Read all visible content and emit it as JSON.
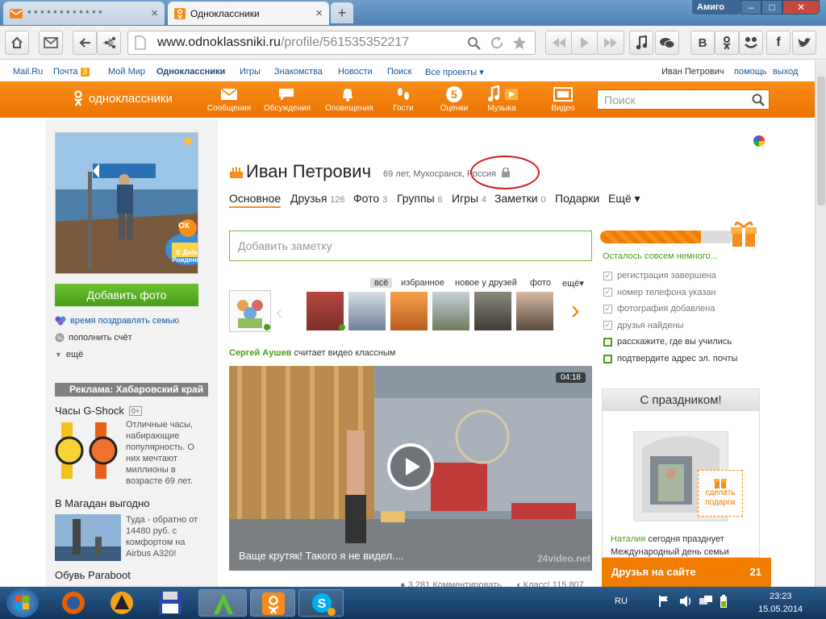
{
  "window": {
    "tabs": [
      {
        "title": "* * * * * * * * * * * *",
        "icon": "mail-icon"
      },
      {
        "title": "Одноклассники",
        "icon": "ok-icon"
      }
    ],
    "profile_label": "Амиго",
    "new_tab": "+"
  },
  "toolbar": {
    "url_main": "www.odnoklassniki.ru",
    "url_path": "/profile/561535352217"
  },
  "util_links": {
    "mailru": "Mail.Ru",
    "pochta": "Почта",
    "pochta_count": "3",
    "moymir": "Мой Мир",
    "ok": "Одноклассники",
    "igry": "Игры",
    "znakomstva": "Знакомства",
    "novosti": "Новости",
    "poisk": "Поиск",
    "all_projects": "Все проекты",
    "user": "Иван Петрович",
    "help": "помощь",
    "exit": "выход"
  },
  "okbar": {
    "logo": "одноклассники",
    "nav": [
      "Сообщения",
      "Обсуждения",
      "Оповещения",
      "Гости",
      "Оценки",
      "Музыка",
      "Видео"
    ],
    "search_placeholder": "Поиск"
  },
  "left": {
    "add_photo": "Добавить фото",
    "congrats_link": "время поздравлять семью",
    "topup": "пополнить счёт",
    "more": "ещё",
    "ad_header": "Реклама: Хабаровский край",
    "ads": [
      {
        "title": "Часы G-Shock",
        "badge": "0+",
        "text": "Отличные часы, набирающие популярность. О них мечтают миллионы в возрасте 69 лет."
      },
      {
        "title": "В Магадан выгодно",
        "text": "Туда - обратно от 14480 руб. с комфортом на Airbus A320!"
      },
      {
        "title": "Обувь Paraboot"
      }
    ],
    "avatar_badge_top": "ОК",
    "avatar_badge_text": "С Днём Рождения"
  },
  "profile": {
    "name": "Иван Петрович",
    "info": "69 лет, Мухосранск, Россия",
    "tabs": [
      {
        "label": "Основное",
        "count": ""
      },
      {
        "label": "Друзья",
        "count": "126"
      },
      {
        "label": "Фото",
        "count": "3"
      },
      {
        "label": "Группы",
        "count": "6"
      },
      {
        "label": "Игры",
        "count": "4"
      },
      {
        "label": "Заметки",
        "count": "0"
      },
      {
        "label": "Подарки",
        "count": ""
      },
      {
        "label": "Ещё ▾",
        "count": ""
      }
    ],
    "note_placeholder": "Добавить заметку"
  },
  "friend_tabs": [
    "всё",
    "избранное",
    "новое у друзей",
    "фото",
    "ещё▾"
  ],
  "feed": {
    "author": "Сергей Аушев",
    "action": "считает видео классным",
    "video_time": "04:18",
    "video_caption": "Ваще крутяк! Такого я не видел....",
    "video_watermark": "24video.net",
    "stats_views": "3 281",
    "stats_comment": "Комментировать",
    "stats_class": "Класс! 115 807"
  },
  "progress": {
    "fraction": 0.75,
    "label": "Осталось совсем немного...",
    "items": [
      {
        "text": "регистрация завершена",
        "done": true
      },
      {
        "text": "номер телефона указан",
        "done": true
      },
      {
        "text": "фотография добавлена",
        "done": true
      },
      {
        "text": "друзья найдены",
        "done": true
      },
      {
        "text": "расскажите, где вы учились",
        "done": false
      },
      {
        "text": "подтвердите адрес эл. почты",
        "done": false
      }
    ]
  },
  "holiday": {
    "title": "С праздником!",
    "gift_btn": "сделать подарок",
    "person": "Наталия",
    "text": "сегодня празднует Международный день семьи"
  },
  "friends_online": {
    "label": "Друзья на сайте",
    "count": "21"
  },
  "taskbar": {
    "lang": "RU",
    "time": "23:23",
    "date": "15.05.2014"
  },
  "colors": {
    "ok_orange": "#f78d1c",
    "ok_green": "#4a9e1a",
    "link_blue": "#155aa0"
  }
}
